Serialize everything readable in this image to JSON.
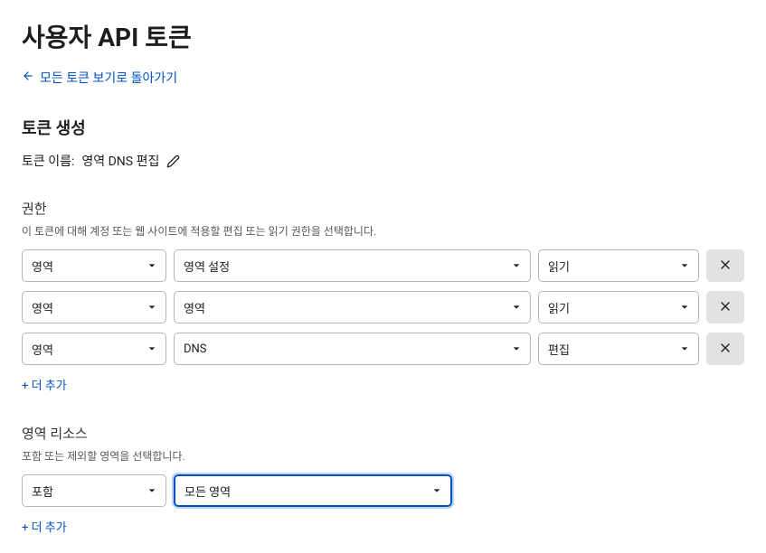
{
  "page": {
    "title": "사용자 API 토큰",
    "back_link": "모든 토큰 보기로 돌아가기"
  },
  "token": {
    "section_heading": "토큰 생성",
    "name_label": "토큰 이름:",
    "name_value": "영역 DNS 편집"
  },
  "permissions": {
    "label": "권한",
    "description": "이 토큰에 대해 계정 또는 웹 사이트에 적용할 편집 또는 읽기 권한을 선택합니다.",
    "rows": [
      {
        "scope": "영역",
        "resource": "영역 설정",
        "access": "읽기"
      },
      {
        "scope": "영역",
        "resource": "영역",
        "access": "읽기"
      },
      {
        "scope": "영역",
        "resource": "DNS",
        "access": "편집"
      }
    ],
    "add_more": "+ 더 추가"
  },
  "zone_resources": {
    "label": "영역 리소스",
    "description": "포함 또는 제외할 영역을 선택합니다.",
    "rows": [
      {
        "include": "포함",
        "target": "모든 영역"
      }
    ],
    "add_more": "+ 더 추가"
  }
}
